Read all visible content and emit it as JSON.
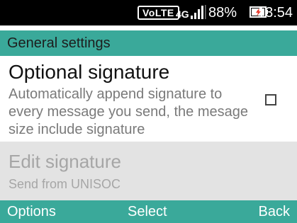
{
  "status_bar": {
    "volte": "VoLTE",
    "network": "4G",
    "battery_percent": "88%",
    "time": "13:54",
    "signal_icon": "signal-bars-icon",
    "battery_icon": "battery-charging-icon"
  },
  "header": {
    "title": "General settings"
  },
  "options": [
    {
      "title": "Optional signature",
      "description": "Automatically append signature to every message you send, the mesage size include signature",
      "checked": false
    },
    {
      "title": "Edit signature",
      "description": "Send from UNISOC",
      "disabled": true
    }
  ],
  "softkeys": {
    "left": "Options",
    "center": "Select",
    "right": "Back"
  },
  "colors": {
    "accent": "#3aa99a",
    "status_bar": "#000000",
    "disabled_bg": "#e3e3e3"
  }
}
